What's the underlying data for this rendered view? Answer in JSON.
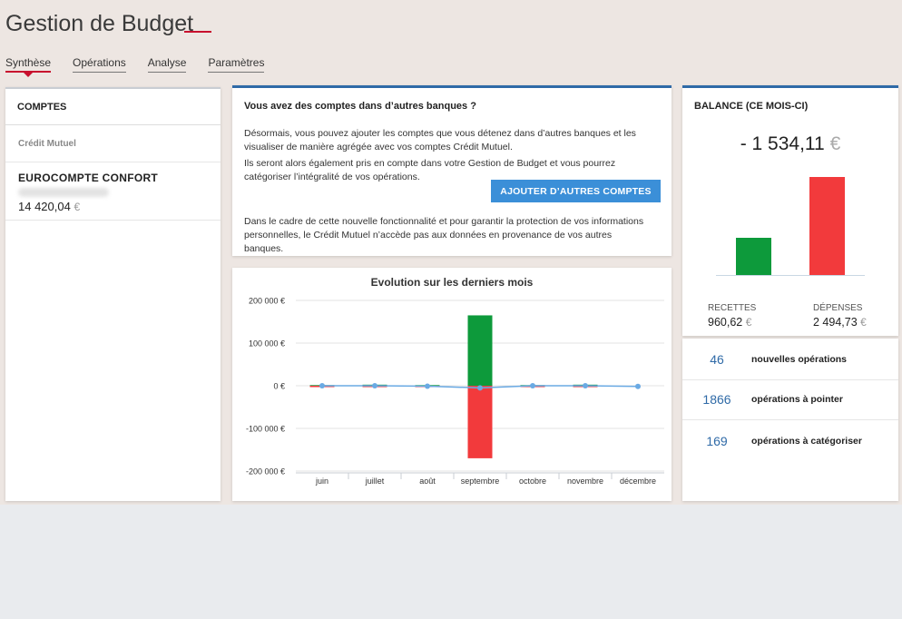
{
  "header": {
    "title": "Gestion de Budget"
  },
  "tabs": [
    {
      "label": "Synthèse",
      "active": true
    },
    {
      "label": "Opérations",
      "active": false
    },
    {
      "label": "Analyse",
      "active": false
    },
    {
      "label": "Paramètres",
      "active": false
    }
  ],
  "comptes": {
    "heading": "COMPTES",
    "bank": "Crédit Mutuel",
    "account_name": "EUROCOMPTE CONFORT",
    "account_balance": "14 420,04",
    "currency": "€"
  },
  "info": {
    "title": "Vous avez des comptes dans d’autres banques ?",
    "p1": "Désormais, vous pouvez ajouter les comptes que vous détenez dans d’autres banques et les visualiser de manière agrégée avec vos comptes Crédit Mutuel.",
    "p2": "Ils seront alors également pris en compte dans votre Gestion de Budget et vous pourrez catégoriser l’intégralité de vos opérations.",
    "button_label": "AJOUTER D’AUTRES COMPTES",
    "p3": "Dans le cadre de cette nouvelle fonctionnalité et pour garantir la protection de vos informations personnelles, le Crédit Mutuel n’accède pas aux données en provenance de vos autres banques."
  },
  "balance": {
    "heading": "BALANCE (CE MOIS-CI)",
    "amount": "- 1 534,11",
    "currency": "€",
    "recettes_label": "RECETTES",
    "recettes_value": "960,62",
    "depenses_label": "DÉPENSES",
    "depenses_value": "2 494,73"
  },
  "operations": [
    {
      "count": "46",
      "label": "nouvelles opérations"
    },
    {
      "count": "1866",
      "label": "opérations à pointer"
    },
    {
      "count": "169",
      "label": "opérations à catégoriser"
    }
  ],
  "colors": {
    "accent_red": "#c8102e",
    "blue": "#2f6aa7",
    "button_blue": "#3b8fd8",
    "green": "#0d9a3b",
    "red": "#f23a3c",
    "line": "#6aaae4"
  },
  "chart_data": {
    "type": "bar",
    "title": "Evolution sur les derniers mois",
    "categories": [
      "juin",
      "juillet",
      "août",
      "septembre",
      "octobre",
      "novembre",
      "décembre"
    ],
    "series": [
      {
        "values": [
          1500,
          2500,
          1500,
          165000,
          1500,
          2500,
          0
        ],
        "color": "#0d9a3b"
      },
      {
        "values": [
          -1500,
          -2500,
          -2500,
          -170000,
          -1500,
          -2500,
          0
        ],
        "color": "#f23a3c"
      },
      {
        "type": "line",
        "values": [
          0,
          0,
          -1000,
          -5000,
          0,
          0,
          -1534
        ],
        "color": "#6aaae4"
      }
    ],
    "ytick_labels": [
      "200 000 €",
      "100 000 €",
      "0 €",
      "-100 000 €",
      "-200 000 €"
    ],
    "ylim": [
      -200000,
      200000
    ],
    "grid": true
  }
}
